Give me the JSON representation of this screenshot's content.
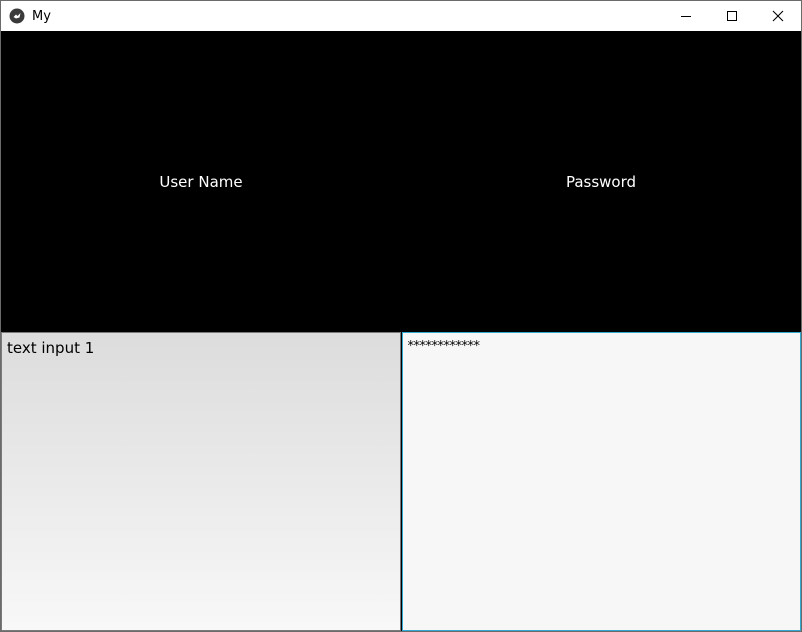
{
  "window": {
    "title": "My",
    "controls": {
      "minimize": "minimize-icon",
      "maximize": "maximize-icon",
      "close": "close-icon"
    }
  },
  "labels": {
    "username": "User Name",
    "password": "Password"
  },
  "inputs": {
    "username_value": "text input 1",
    "password_value": "************"
  },
  "colors": {
    "background": "#000000",
    "label_text": "#ffffff",
    "focus_border": "#33a8d0"
  }
}
